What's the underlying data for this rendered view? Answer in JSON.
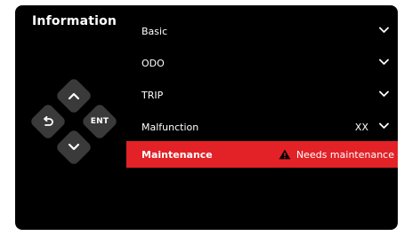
{
  "screen": {
    "title": "Information"
  },
  "dpad": {
    "enter_label": "ENT",
    "icons": [
      "chevron-up-icon",
      "back-icon",
      "chevron-down-icon"
    ]
  },
  "menu": {
    "items": [
      {
        "label": "Basic",
        "value": ""
      },
      {
        "label": "ODO",
        "value": ""
      },
      {
        "label": "TRIP",
        "value": ""
      },
      {
        "label": "Malfunction",
        "value": "XX"
      },
      {
        "label": "Maintenance",
        "status": "Needs maintenance"
      }
    ],
    "selected_index": 4
  },
  "colors": {
    "background": "#000000",
    "highlight": "#e22227",
    "button": "#3a3a3a",
    "text": "#ffffff"
  }
}
